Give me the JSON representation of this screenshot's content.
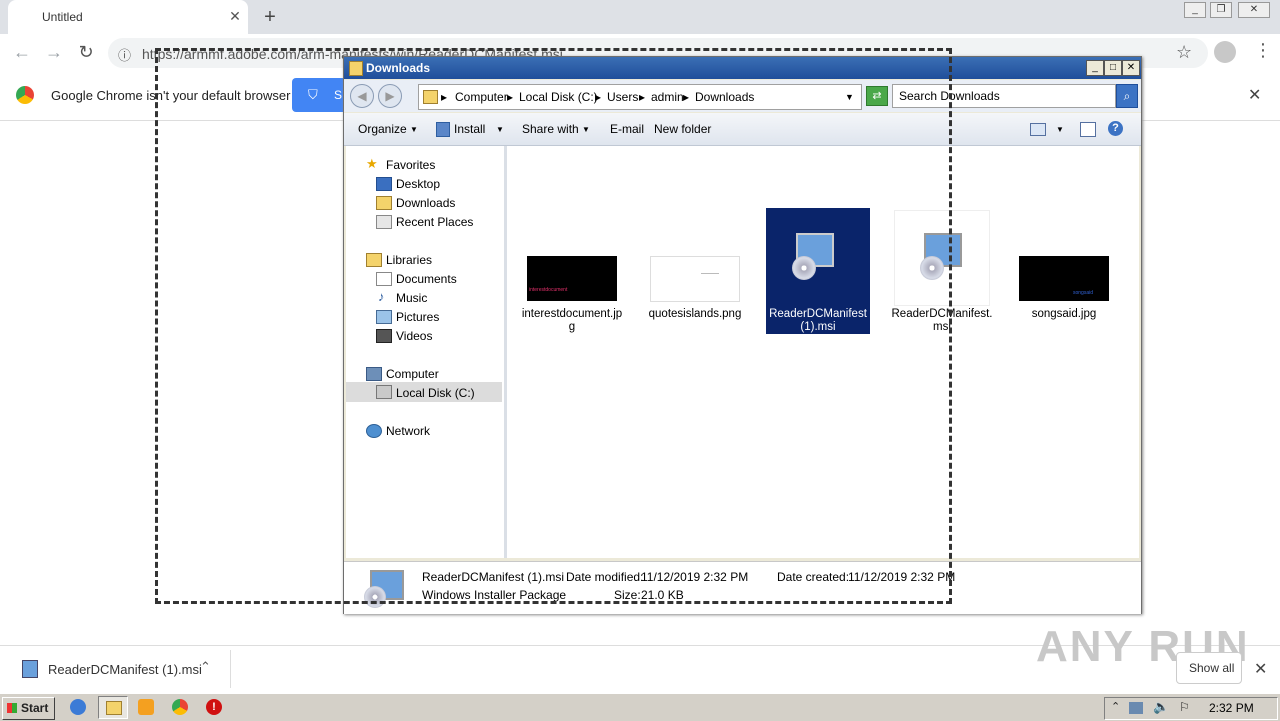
{
  "browser": {
    "tab_title": "Untitled",
    "tab_close": "✕",
    "new_tab": "+",
    "url": "https://armmf.adobe.com/arm-manifests/win/ReaderDCManifest.msi",
    "infobar_text": "Google Chrome isn't your default browser",
    "infobar_button": "S"
  },
  "explorer": {
    "title": "Downloads",
    "breadcrumbs": [
      "Computer",
      "Local Disk (C:)",
      "Users",
      "admin",
      "Downloads"
    ],
    "search_placeholder": "Search Downloads",
    "commands": {
      "organize": "Organize",
      "install": "Install",
      "share_with": "Share with",
      "email": "E-mail",
      "new_folder": "New folder"
    },
    "nav": {
      "favorites": "Favorites",
      "desktop": "Desktop",
      "downloads": "Downloads",
      "recent_places": "Recent Places",
      "libraries": "Libraries",
      "documents": "Documents",
      "music": "Music",
      "pictures": "Pictures",
      "videos": "Videos",
      "computer": "Computer",
      "local_disk": "Local Disk (C:)",
      "network": "Network"
    },
    "files": [
      {
        "name": "interestdocument.jpg",
        "thumb_text": "interestdocument"
      },
      {
        "name": "quotesislands.png"
      },
      {
        "name": "ReaderDCManifest (1).msi",
        "selected": true
      },
      {
        "name": "ReaderDCManifest.msi"
      },
      {
        "name": "songsaid.jpg",
        "thumb_text": "songsaid"
      }
    ],
    "details": {
      "name": "ReaderDCManifest (1).msi",
      "type": "Windows Installer Package",
      "date_modified_label": "Date modified:",
      "date_modified": "11/12/2019 2:32 PM",
      "date_created_label": "Date created:",
      "date_created": "11/12/2019 2:32 PM",
      "size_label": "Size:",
      "size": "21.0 KB"
    }
  },
  "shelf": {
    "download_name": "ReaderDCManifest (1).msi",
    "show_all": "Show all"
  },
  "taskbar": {
    "start": "Start",
    "clock": "2:32 PM"
  },
  "watermark": "ANY RUN",
  "colors": {
    "selection": "#0a246a",
    "titlebar": "#2a5ca8",
    "chrome_blue": "#4285f4"
  }
}
